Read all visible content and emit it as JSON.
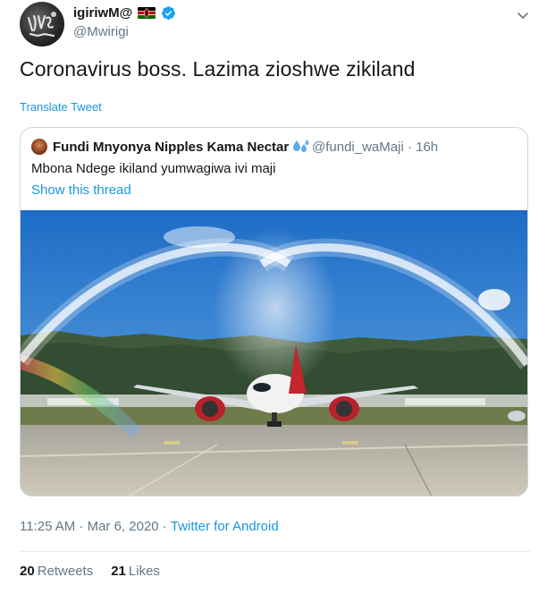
{
  "author": {
    "name": "igiriwM@",
    "handle": "@Mwirigi"
  },
  "tweet": {
    "text": "Coronavirus boss. Lazima zioshwe zikiland",
    "translate_label": "Translate Tweet"
  },
  "quoted": {
    "name": "Fundi Mnyonya Nipples Kama Nectar",
    "handle_time": "@fundi_waMaji · 16h",
    "text": "Mbona Ndege ikiland yumwagiwa ivi maji",
    "show_thread": "Show this thread",
    "media_icon": "airplane-water-salute-photo"
  },
  "meta": {
    "time": "11:25 AM · Mar 6, 2020 ·",
    "source": "Twitter for Android"
  },
  "stats": {
    "retweets_count": "20",
    "retweets_label": "Retweets",
    "likes_count": "21",
    "likes_label": "Likes"
  },
  "colors": {
    "link": "#1b95e0",
    "secondary": "#657786",
    "primary": "#14171a",
    "border": "#ccd6dd"
  },
  "icons": {
    "caret": "chevron-down-icon",
    "verified": "verified-badge-icon",
    "flag": "kenya-flag-icon",
    "drops": "sweat-droplets-icon"
  }
}
